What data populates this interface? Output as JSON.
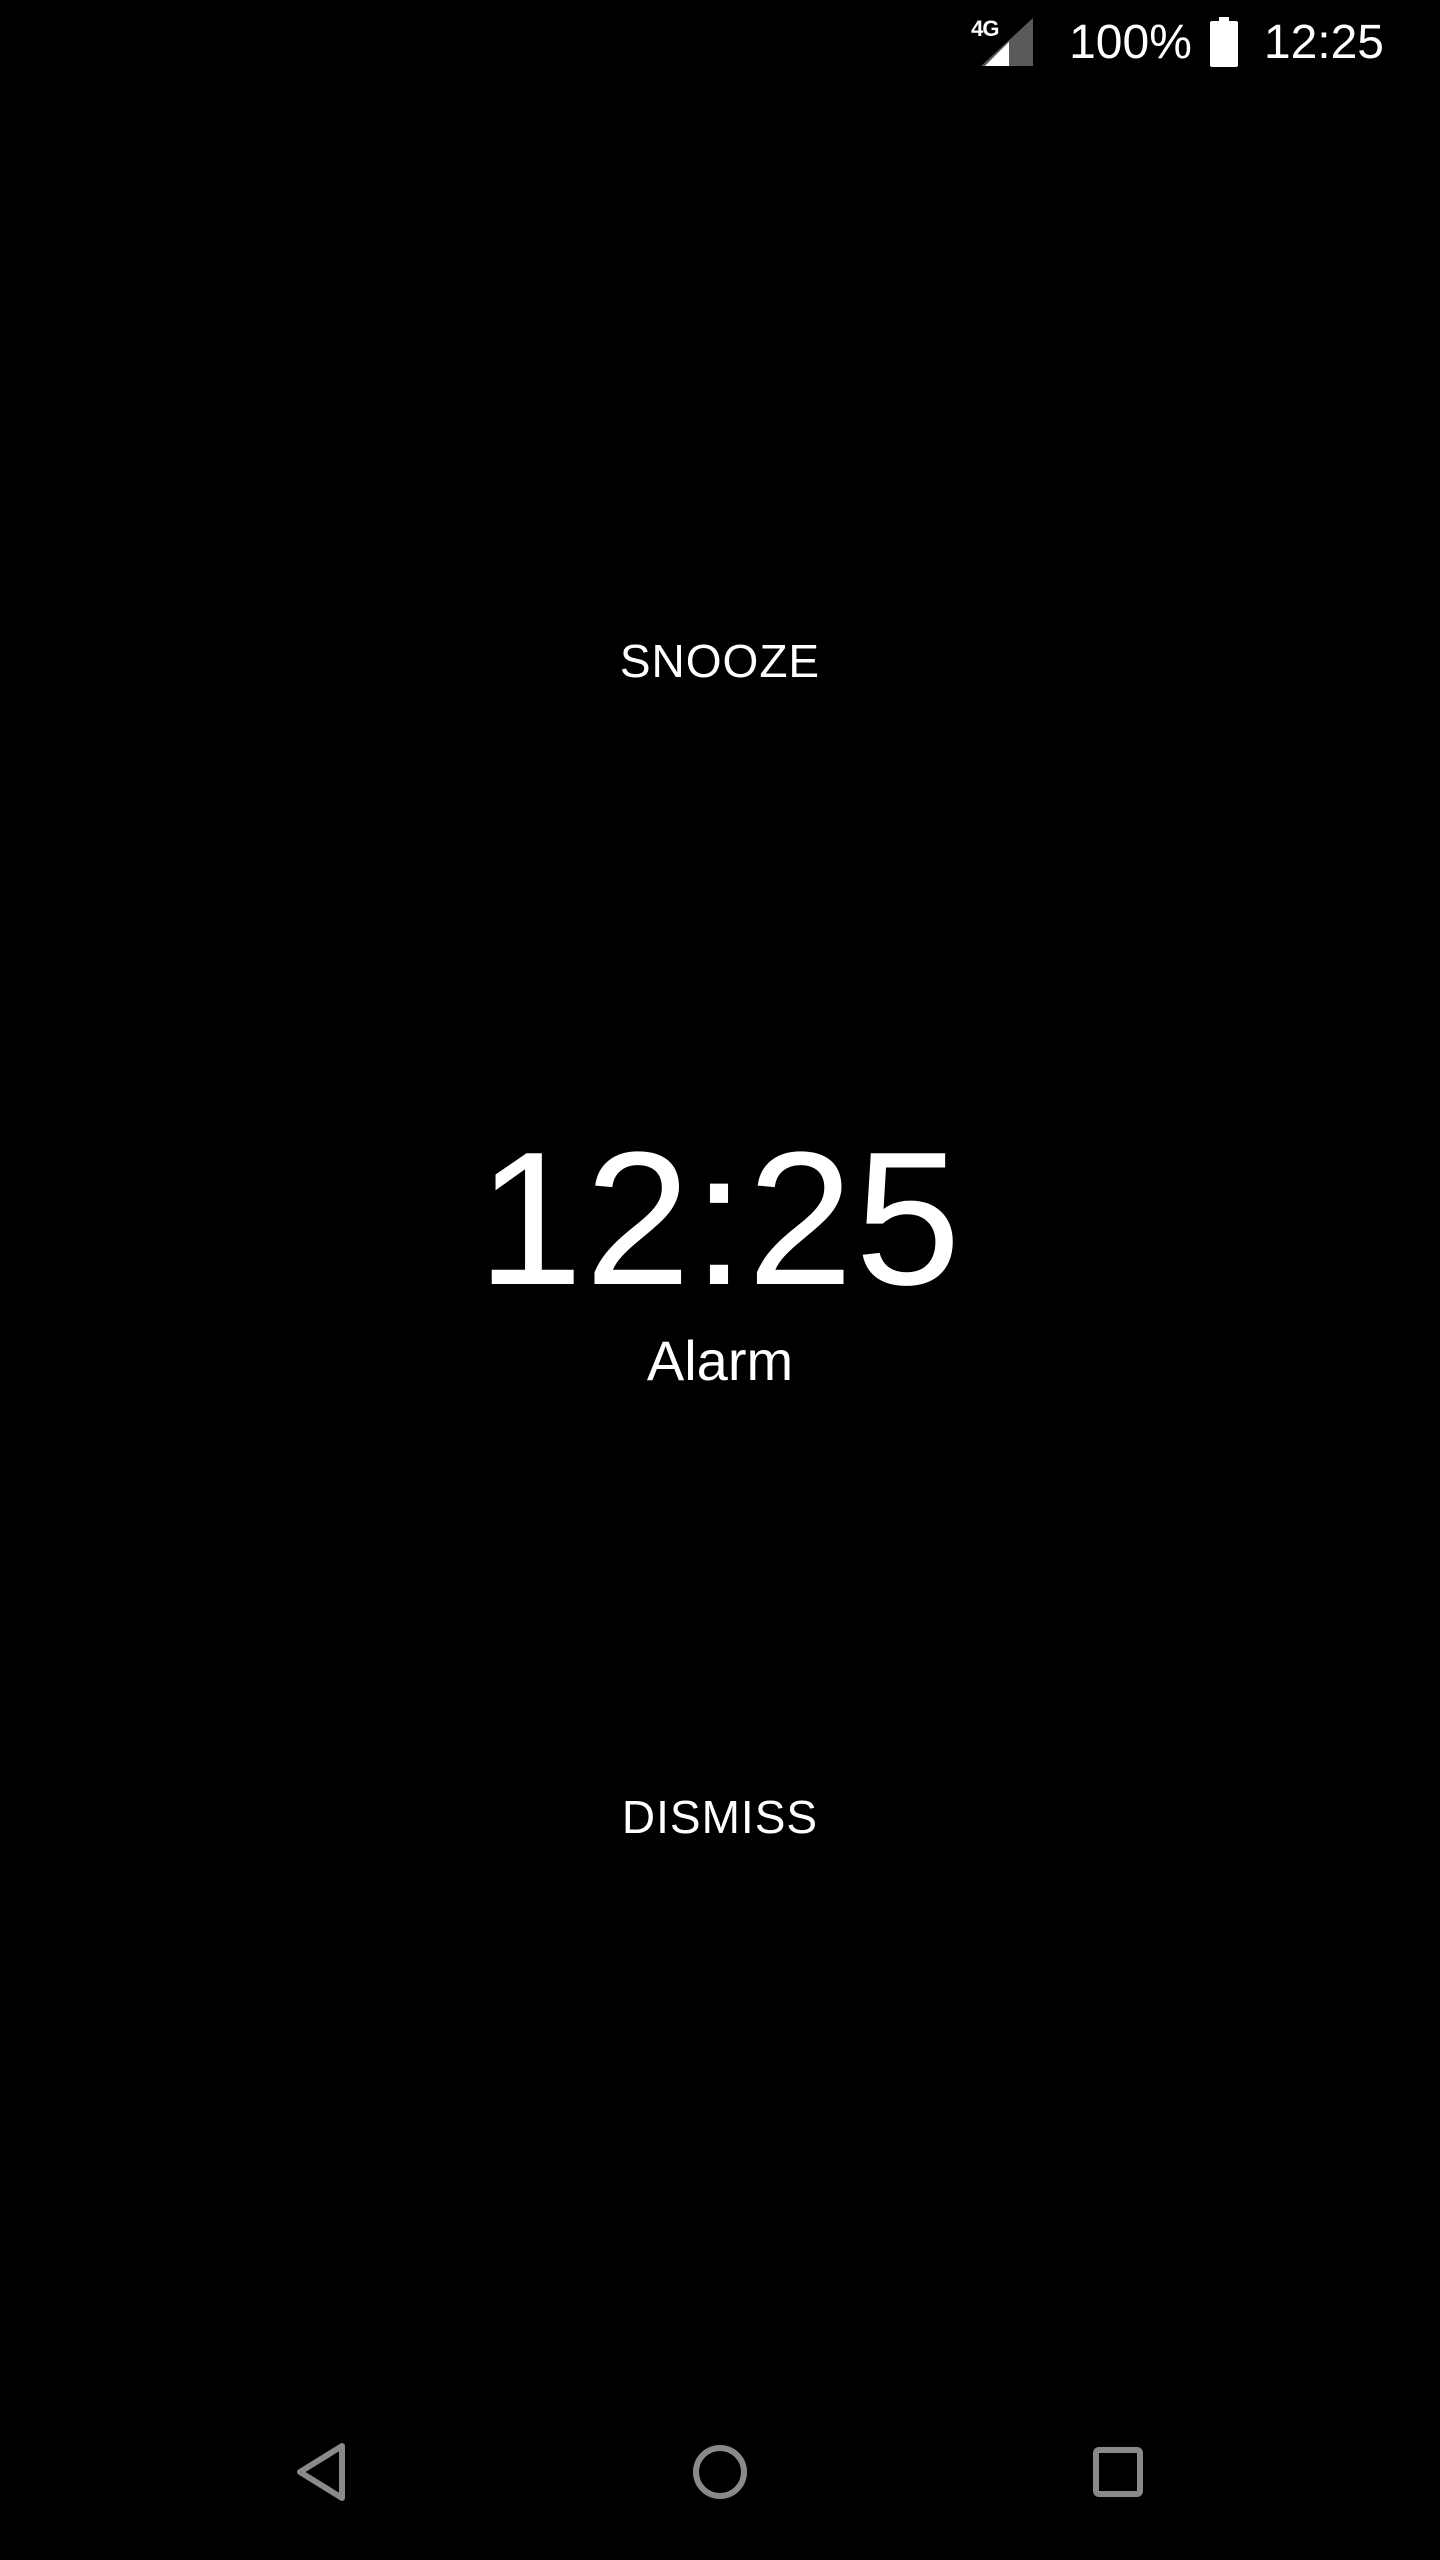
{
  "status_bar": {
    "network_type": "4G",
    "battery_percent": "100%",
    "time": "12:25",
    "icons": [
      "signal-icon",
      "battery-icon"
    ]
  },
  "alarm": {
    "snooze_label": "SNOOZE",
    "time": "12:25",
    "label": "Alarm",
    "dismiss_label": "DISMISS"
  },
  "nav_bar": {
    "icons": [
      "back-icon",
      "home-icon",
      "recents-icon"
    ]
  },
  "colors": {
    "background": "#000000",
    "foreground": "#ffffff",
    "nav_icon": "#8a8a8a"
  }
}
